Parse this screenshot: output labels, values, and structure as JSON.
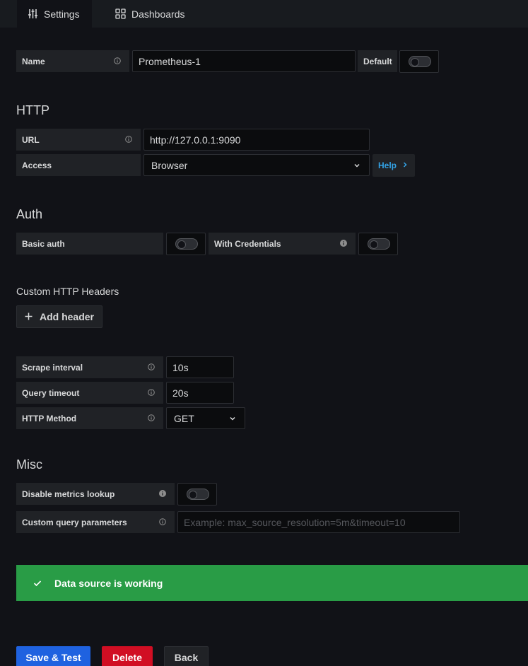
{
  "tabs": {
    "settings": "Settings",
    "dashboards": "Dashboards"
  },
  "name_row": {
    "label": "Name",
    "value": "Prometheus-1",
    "default_label": "Default",
    "default_enabled": false
  },
  "http": {
    "heading": "HTTP",
    "url_label": "URL",
    "url_value": "http://127.0.0.1:9090",
    "access_label": "Access",
    "access_value": "Browser",
    "help_label": "Help"
  },
  "auth": {
    "heading": "Auth",
    "basic_auth_label": "Basic auth",
    "basic_auth_enabled": false,
    "with_credentials_label": "With Credentials",
    "with_credentials_enabled": false
  },
  "custom_headers": {
    "heading": "Custom HTTP Headers",
    "add_label": "Add header"
  },
  "prometheus": {
    "scrape_label": "Scrape interval",
    "scrape_value": "10s",
    "timeout_label": "Query timeout",
    "timeout_value": "20s",
    "method_label": "HTTP Method",
    "method_value": "GET"
  },
  "misc": {
    "heading": "Misc",
    "disable_lookup_label": "Disable metrics lookup",
    "disable_lookup_enabled": false,
    "custom_params_label": "Custom query parameters",
    "custom_params_placeholder": "Example: max_source_resolution=5m&timeout=10"
  },
  "alert": {
    "message": "Data source is working"
  },
  "actions": {
    "save_label": "Save & Test",
    "delete_label": "Delete",
    "back_label": "Back"
  },
  "colors": {
    "background": "#111217",
    "success": "#299c46",
    "primary": "#1f62e0",
    "danger": "#d10e23",
    "link": "#33a2e5"
  }
}
